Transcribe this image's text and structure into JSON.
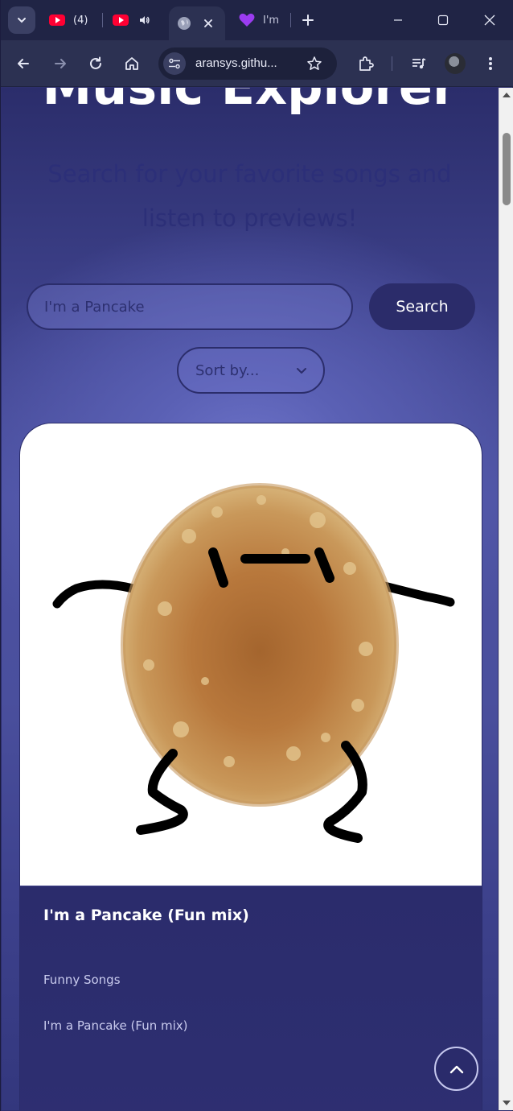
{
  "browser": {
    "tabs": [
      {
        "icon": "youtube-icon",
        "label": "(4)"
      },
      {
        "icon": "youtube-icon",
        "label": "",
        "audio": true
      },
      {
        "icon": "globe-icon",
        "label": "",
        "active": true
      },
      {
        "icon": "purple-heart-icon",
        "label": "I'm"
      }
    ],
    "address": "aransys.githu..."
  },
  "page": {
    "title": "Music Explorer",
    "subtitle": "Search for your favorite songs and listen to previews!",
    "search": {
      "value": "I'm a Pancake",
      "button_label": "Search"
    },
    "sort": {
      "selected": "Sort by..."
    },
    "results": [
      {
        "title": "I'm a Pancake (Fun mix)",
        "album": "Funny Songs",
        "track": "I'm a Pancake (Fun mix)"
      }
    ]
  },
  "colors": {
    "brand_dark": "#2b2c6a",
    "accent": "#5a60b4",
    "card_body": "#2c2d6e"
  }
}
